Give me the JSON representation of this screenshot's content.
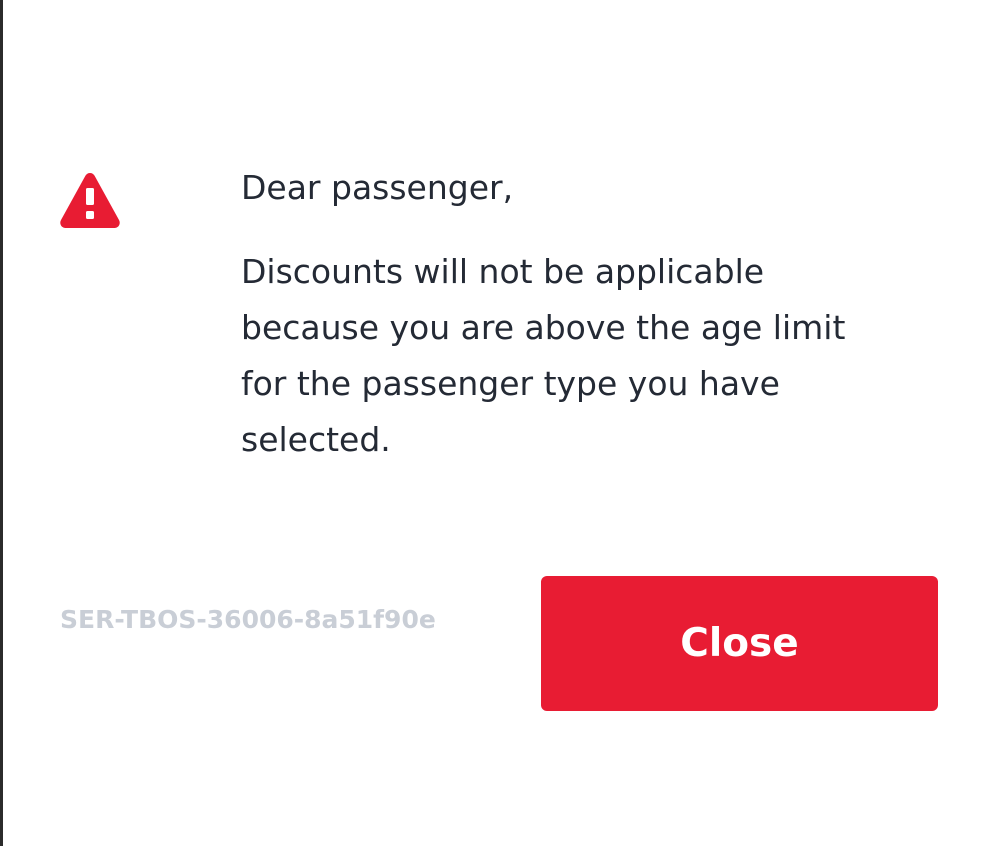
{
  "dialog": {
    "icon": "warning-triangle-icon",
    "accent_color": "#e81c33",
    "greeting": "Dear passenger,",
    "message_lines": [
      "Discounts will not be applicable",
      "because you are above the age limit",
      "for the passenger type you have",
      "selected."
    ],
    "error_code": "SER-TBOS-36006-8a51f90e",
    "close_label": "Close"
  }
}
